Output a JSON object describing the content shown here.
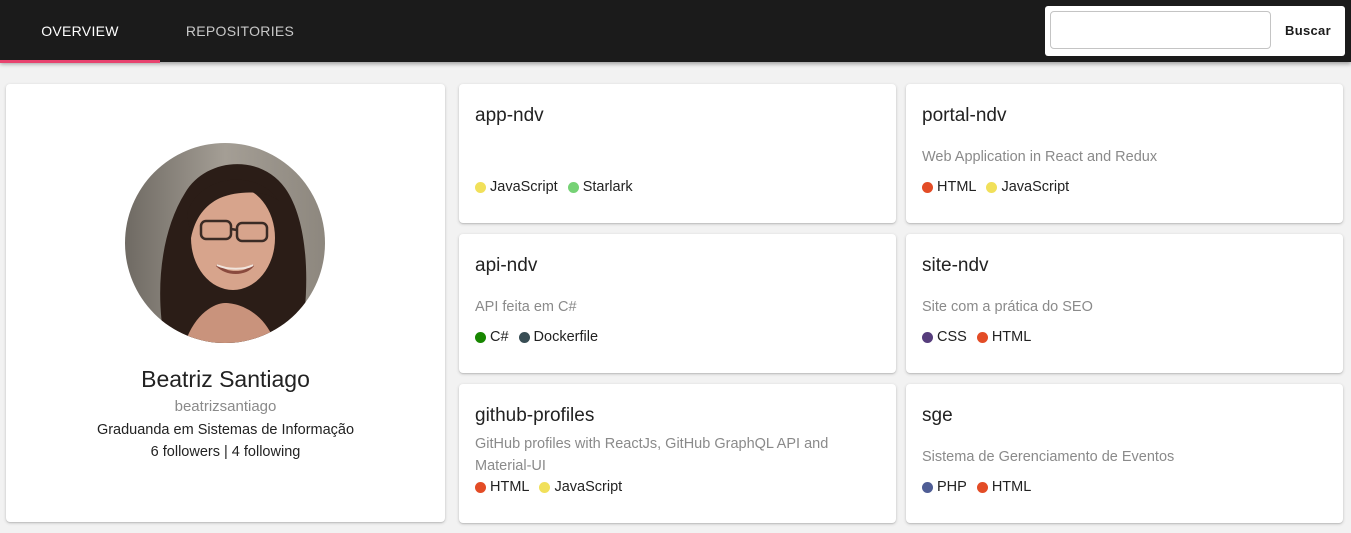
{
  "nav": {
    "tabs": [
      {
        "label": "Overview"
      },
      {
        "label": "Repositories"
      }
    ],
    "active_tab": "Overview",
    "accent_color": "#e8436f"
  },
  "search": {
    "value": "",
    "placeholder": "",
    "button_label": "Buscar"
  },
  "profile": {
    "name": "Beatriz Santiago",
    "login": "beatrizsantiago",
    "bio": "Graduanda em Sistemas de Informação",
    "follow_text": "6 followers | 4 following"
  },
  "repositories": [
    {
      "name": "app-ndv",
      "description": "",
      "languages": [
        {
          "name": "JavaScript",
          "color": "#f1e05a"
        },
        {
          "name": "Starlark",
          "color": "#76d275"
        }
      ]
    },
    {
      "name": "portal-ndv",
      "description": "Web Application in React and Redux",
      "languages": [
        {
          "name": "HTML",
          "color": "#e34c26"
        },
        {
          "name": "JavaScript",
          "color": "#f1e05a"
        }
      ]
    },
    {
      "name": "api-ndv",
      "description": "API feita em C#",
      "languages": [
        {
          "name": "C#",
          "color": "#178600"
        },
        {
          "name": "Dockerfile",
          "color": "#384d54"
        }
      ]
    },
    {
      "name": "site-ndv",
      "description": "Site com a prática do SEO",
      "languages": [
        {
          "name": "CSS",
          "color": "#563d7c"
        },
        {
          "name": "HTML",
          "color": "#e34c26"
        }
      ]
    },
    {
      "name": "github-profiles",
      "description": "GitHub profiles with ReactJs, GitHub GraphQL API and Material-UI",
      "languages": [
        {
          "name": "HTML",
          "color": "#e34c26"
        },
        {
          "name": "JavaScript",
          "color": "#f1e05a"
        }
      ]
    },
    {
      "name": "sge",
      "description": "Sistema de Gerenciamento de Eventos",
      "languages": [
        {
          "name": "PHP",
          "color": "#4F5D95"
        },
        {
          "name": "HTML",
          "color": "#e34c26"
        }
      ]
    }
  ]
}
